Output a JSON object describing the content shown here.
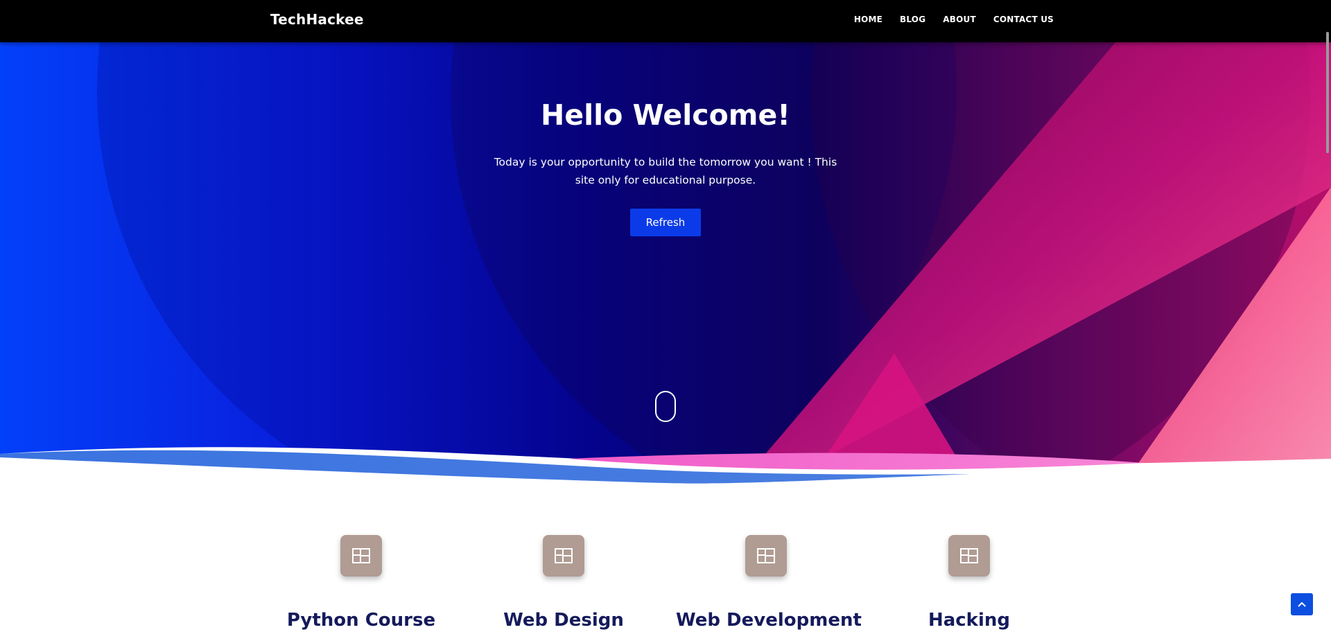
{
  "navbar": {
    "brand": "TechHackee",
    "links": [
      "HOME",
      "BLOG",
      "ABOUT",
      "CONTACT US"
    ]
  },
  "hero": {
    "title": "Hello Welcome!",
    "text": "Today is your opportunity to build the tomorrow you want ! This site only for educational purpose.",
    "button_label": "Refresh"
  },
  "features": [
    {
      "title": "Python Course",
      "icon": "layout-icon"
    },
    {
      "title": "Web Design",
      "icon": "layout-icon"
    },
    {
      "title": "Web Development",
      "icon": "layout-icon"
    },
    {
      "title": "Hacking",
      "icon": "layout-icon"
    }
  ],
  "colors": {
    "navbar_bg": "#000000",
    "hero_blue": "#0a3cf0",
    "hero_navy": "#07086e",
    "hero_pink": "#e0127d",
    "button": "#0b3be8",
    "icon_bg": "#b09c93",
    "feature_title": "#151a5c",
    "back_to_top": "#0b4ee0"
  }
}
